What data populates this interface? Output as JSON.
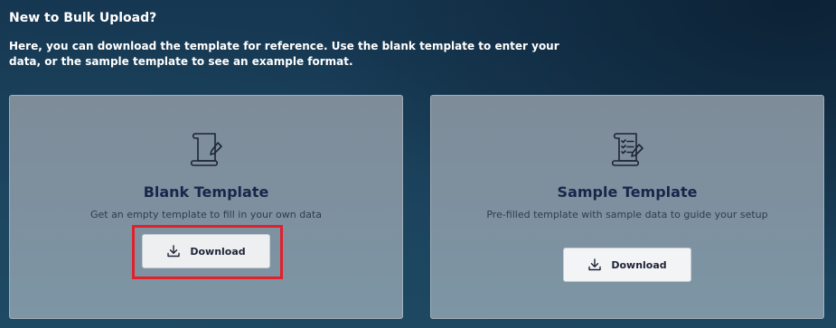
{
  "header": {
    "title": "New to Bulk Upload?",
    "description": "Here, you can download the template for reference. Use the blank template to enter your data, or the sample template to see an example format."
  },
  "cards": {
    "blank": {
      "icon": "blank-document-icon",
      "title": "Blank Template",
      "description": "Get an empty template to fill in your own data",
      "button_label": "Download",
      "button_icon": "download-icon"
    },
    "sample": {
      "icon": "sample-document-icon",
      "title": "Sample Template",
      "description": "Pre-filled template with sample data to guide your setup",
      "button_label": "Download",
      "button_icon": "download-icon"
    }
  },
  "colors": {
    "highlight": "#e0202b",
    "card_title": "#17264a",
    "background": "#183a52"
  }
}
